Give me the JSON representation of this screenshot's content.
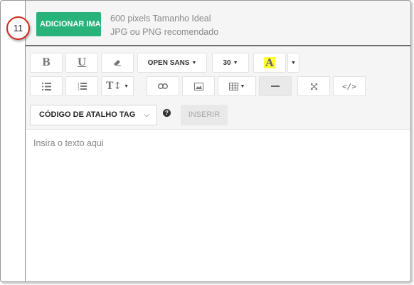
{
  "upload": {
    "button_label": "ADICIONAR IMAGEM",
    "hint_line1": "600 pixels Tamanho Ideal",
    "hint_line2": "JPG ou PNG recomendado"
  },
  "step_badge": "11",
  "toolbar": {
    "bold_icon": "B",
    "underline_icon": "U",
    "eraser_icon": "eraser-icon",
    "font_family": "OPEN SANS",
    "font_size": "30",
    "text_color_icon": "A",
    "font_size_toggle_icon": "T↕",
    "link_icon": "link-icon",
    "image_icon": "image-icon",
    "table_icon": "table-icon",
    "hr_icon": "horizontal-rule-icon",
    "fullscreen_icon": "fullscreen-icon",
    "code_view_label": "</>",
    "highlight_color": "#ffff33"
  },
  "shortcut": {
    "dropdown_label": "CÓDIGO DE ATALHO TAG",
    "help_icon": "?",
    "insert_label": "INSERIR"
  },
  "editor": {
    "placeholder": "Insira o texto aqui"
  },
  "colors": {
    "accent_green": "#2ab27b",
    "badge_red": "#d0281c"
  }
}
